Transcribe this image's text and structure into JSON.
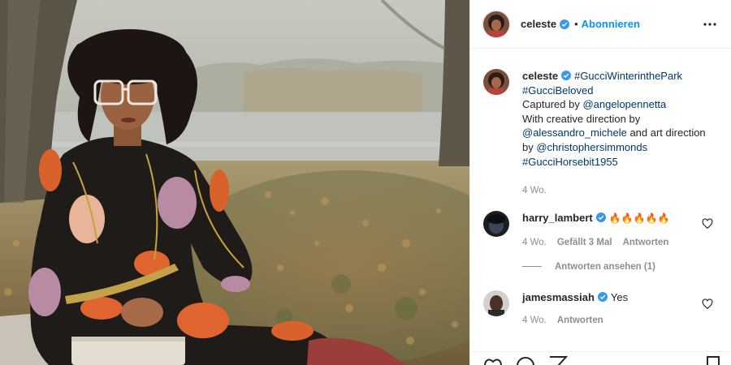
{
  "post": {
    "author": "celeste",
    "follow_label": "Abonnieren",
    "caption": {
      "hashtag1": "#GucciWinterinthePark",
      "hashtag2": "#GucciBeloved",
      "captured_prefix": "Captured by ",
      "mention1": "@angelopennetta",
      "creative_prefix": "With creative direction by",
      "mention2": "@alessandro_michele",
      "art_mid": " and art direction by ",
      "mention3": "@christophersimmonds",
      "hashtag3": "#GucciHorsebit1955",
      "time": "4 Wo."
    }
  },
  "comments": [
    {
      "user": "harry_lambert",
      "text": "🔥🔥🔥🔥🔥",
      "time": "4 Wo.",
      "likes": "Gefällt 3 Mal",
      "reply_label": "Antworten",
      "view_replies": "Antworten ansehen (1)"
    },
    {
      "user": "jamesmassiah",
      "text": "Yes",
      "time": "4 Wo.",
      "reply_label": "Antworten"
    }
  ],
  "colors": {
    "accent_blue": "#0095f6",
    "verified_blue": "#3897f0",
    "link_navy": "#00376b",
    "secondary_text": "#8e8e8e"
  },
  "icons": [
    "verified-badge-icon",
    "more-options-icon",
    "heart-icon",
    "comment-icon",
    "share-icon",
    "bookmark-icon"
  ]
}
